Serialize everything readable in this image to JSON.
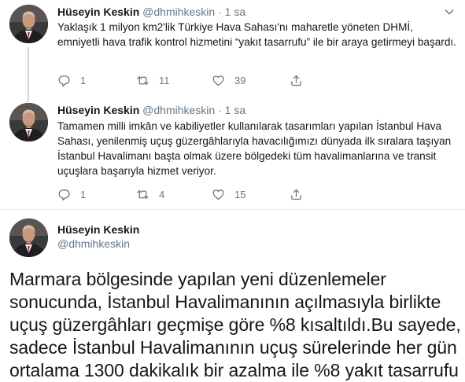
{
  "tweets": [
    {
      "name": "Hüseyin Keskin",
      "handle": "@dhmihkeskin",
      "dot": "·",
      "time": "1 sa",
      "text": "Yaklaşık 1 milyon km2'lik Türkiye Hava Sahası'nı maharetle yöneten DHMİ, emniyetli hava trafik kontrol hizmetini “yakıt tasarrufu” ile bir araya getirmeyi başardı.",
      "reply_count": "1",
      "retweet_count": "11",
      "like_count": "39"
    },
    {
      "name": "Hüseyin Keskin",
      "handle": "@dhmihkeskin",
      "dot": "·",
      "time": "1 sa",
      "text": "Tamamen milli imkân ve kabiliyetler kullanılarak tasarımları yapılan İstanbul Hava Sahası, yenilenmiş uçuş güzergâhlarıyla havacılığımızı dünyada ilk sıralara taşıyan İstanbul Havalimanı başta olmak üzere bölgedeki tüm havalimanlarına ve transit uçuşlara başarıyla hizmet veriyor.",
      "reply_count": "1",
      "retweet_count": "4",
      "like_count": "15"
    }
  ],
  "main_tweet": {
    "name": "Hüseyin Keskin",
    "handle": "@dhmihkeskin",
    "text": "Marmara bölgesinde yapılan yeni düzenlemeler sonucunda, İstanbul Havalimanının açılmasıyla birlikte uçuş güzergâhları geçmişe göre %8 kısaltıldı.Bu sayede, sadece İstanbul Havalimanının uçuş sürelerinde her gün ortalama 1300 dakikalık bir azalma ile %8 yakıt tasarrufu"
  },
  "icons": {
    "avatar": "avatar-photo",
    "reply": "reply-icon",
    "retweet": "retweet-icon",
    "like": "heart-icon",
    "share": "share-icon",
    "menu": "chevron-down-icon"
  },
  "colors": {
    "text": "#14171a",
    "secondary": "#657786",
    "divider": "#e6ecf0",
    "thread_line": "#ccd6dd"
  }
}
